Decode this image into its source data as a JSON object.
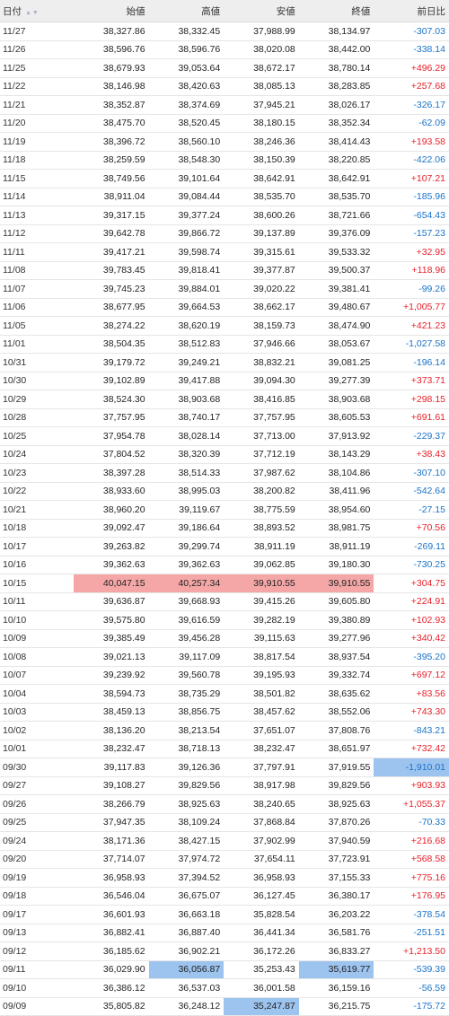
{
  "headers": {
    "date": "日付",
    "open": "始値",
    "high": "高値",
    "low": "安値",
    "close": "終値",
    "change": "前日比"
  },
  "colors": {
    "up": "#e8202a",
    "down": "#1a73c9",
    "highlight_max": "#f5a7a7",
    "highlight_min": "#9dc3ef"
  },
  "rows": [
    {
      "date": "11/27",
      "open": "38,327.86",
      "high": "38,332.45",
      "low": "37,988.99",
      "close": "38,134.97",
      "change": "-307.03"
    },
    {
      "date": "11/26",
      "open": "38,596.76",
      "high": "38,596.76",
      "low": "38,020.08",
      "close": "38,442.00",
      "change": "-338.14"
    },
    {
      "date": "11/25",
      "open": "38,679.93",
      "high": "39,053.64",
      "low": "38,672.17",
      "close": "38,780.14",
      "change": "+496.29"
    },
    {
      "date": "11/22",
      "open": "38,146.98",
      "high": "38,420.63",
      "low": "38,085.13",
      "close": "38,283.85",
      "change": "+257.68"
    },
    {
      "date": "11/21",
      "open": "38,352.87",
      "high": "38,374.69",
      "low": "37,945.21",
      "close": "38,026.17",
      "change": "-326.17"
    },
    {
      "date": "11/20",
      "open": "38,475.70",
      "high": "38,520.45",
      "low": "38,180.15",
      "close": "38,352.34",
      "change": "-62.09"
    },
    {
      "date": "11/19",
      "open": "38,396.72",
      "high": "38,560.10",
      "low": "38,246.36",
      "close": "38,414.43",
      "change": "+193.58"
    },
    {
      "date": "11/18",
      "open": "38,259.59",
      "high": "38,548.30",
      "low": "38,150.39",
      "close": "38,220.85",
      "change": "-422.06"
    },
    {
      "date": "11/15",
      "open": "38,749.56",
      "high": "39,101.64",
      "low": "38,642.91",
      "close": "38,642.91",
      "change": "+107.21"
    },
    {
      "date": "11/14",
      "open": "38,911.04",
      "high": "39,084.44",
      "low": "38,535.70",
      "close": "38,535.70",
      "change": "-185.96"
    },
    {
      "date": "11/13",
      "open": "39,317.15",
      "high": "39,377.24",
      "low": "38,600.26",
      "close": "38,721.66",
      "change": "-654.43"
    },
    {
      "date": "11/12",
      "open": "39,642.78",
      "high": "39,866.72",
      "low": "39,137.89",
      "close": "39,376.09",
      "change": "-157.23"
    },
    {
      "date": "11/11",
      "open": "39,417.21",
      "high": "39,598.74",
      "low": "39,315.61",
      "close": "39,533.32",
      "change": "+32.95"
    },
    {
      "date": "11/08",
      "open": "39,783.45",
      "high": "39,818.41",
      "low": "39,377.87",
      "close": "39,500.37",
      "change": "+118.96"
    },
    {
      "date": "11/07",
      "open": "39,745.23",
      "high": "39,884.01",
      "low": "39,020.22",
      "close": "39,381.41",
      "change": "-99.26"
    },
    {
      "date": "11/06",
      "open": "38,677.95",
      "high": "39,664.53",
      "low": "38,662.17",
      "close": "39,480.67",
      "change": "+1,005.77"
    },
    {
      "date": "11/05",
      "open": "38,274.22",
      "high": "38,620.19",
      "low": "38,159.73",
      "close": "38,474.90",
      "change": "+421.23"
    },
    {
      "date": "11/01",
      "open": "38,504.35",
      "high": "38,512.83",
      "low": "37,946.66",
      "close": "38,053.67",
      "change": "-1,027.58"
    },
    {
      "date": "10/31",
      "open": "39,179.72",
      "high": "39,249.21",
      "low": "38,832.21",
      "close": "39,081.25",
      "change": "-196.14"
    },
    {
      "date": "10/30",
      "open": "39,102.89",
      "high": "39,417.88",
      "low": "39,094.30",
      "close": "39,277.39",
      "change": "+373.71"
    },
    {
      "date": "10/29",
      "open": "38,524.30",
      "high": "38,903.68",
      "low": "38,416.85",
      "close": "38,903.68",
      "change": "+298.15"
    },
    {
      "date": "10/28",
      "open": "37,757.95",
      "high": "38,740.17",
      "low": "37,757.95",
      "close": "38,605.53",
      "change": "+691.61"
    },
    {
      "date": "10/25",
      "open": "37,954.78",
      "high": "38,028.14",
      "low": "37,713.00",
      "close": "37,913.92",
      "change": "-229.37"
    },
    {
      "date": "10/24",
      "open": "37,804.52",
      "high": "38,320.39",
      "low": "37,712.19",
      "close": "38,143.29",
      "change": "+38.43"
    },
    {
      "date": "10/23",
      "open": "38,397.28",
      "high": "38,514.33",
      "low": "37,987.62",
      "close": "38,104.86",
      "change": "-307.10"
    },
    {
      "date": "10/22",
      "open": "38,933.60",
      "high": "38,995.03",
      "low": "38,200.82",
      "close": "38,411.96",
      "change": "-542.64"
    },
    {
      "date": "10/21",
      "open": "38,960.20",
      "high": "39,119.67",
      "low": "38,775.59",
      "close": "38,954.60",
      "change": "-27.15"
    },
    {
      "date": "10/18",
      "open": "39,092.47",
      "high": "39,186.64",
      "low": "38,893.52",
      "close": "38,981.75",
      "change": "+70.56"
    },
    {
      "date": "10/17",
      "open": "39,263.82",
      "high": "39,299.74",
      "low": "38,911.19",
      "close": "38,911.19",
      "change": "-269.11"
    },
    {
      "date": "10/16",
      "open": "39,362.63",
      "high": "39,362.63",
      "low": "39,062.85",
      "close": "39,180.30",
      "change": "-730.25"
    },
    {
      "date": "10/15",
      "open": "40,047.15",
      "high": "40,257.34",
      "low": "39,910.55",
      "close": "39,910.55",
      "change": "+304.75",
      "hl": [
        "open",
        "high",
        "low",
        "close"
      ],
      "hl_type": "max"
    },
    {
      "date": "10/11",
      "open": "39,636.87",
      "high": "39,668.93",
      "low": "39,415.26",
      "close": "39,605.80",
      "change": "+224.91"
    },
    {
      "date": "10/10",
      "open": "39,575.80",
      "high": "39,616.59",
      "low": "39,282.19",
      "close": "39,380.89",
      "change": "+102.93"
    },
    {
      "date": "10/09",
      "open": "39,385.49",
      "high": "39,456.28",
      "low": "39,115.63",
      "close": "39,277.96",
      "change": "+340.42"
    },
    {
      "date": "10/08",
      "open": "39,021.13",
      "high": "39,117.09",
      "low": "38,817.54",
      "close": "38,937.54",
      "change": "-395.20"
    },
    {
      "date": "10/07",
      "open": "39,239.92",
      "high": "39,560.78",
      "low": "39,195.93",
      "close": "39,332.74",
      "change": "+697.12"
    },
    {
      "date": "10/04",
      "open": "38,594.73",
      "high": "38,735.29",
      "low": "38,501.82",
      "close": "38,635.62",
      "change": "+83.56"
    },
    {
      "date": "10/03",
      "open": "38,459.13",
      "high": "38,856.75",
      "low": "38,457.62",
      "close": "38,552.06",
      "change": "+743.30"
    },
    {
      "date": "10/02",
      "open": "38,136.20",
      "high": "38,213.54",
      "low": "37,651.07",
      "close": "37,808.76",
      "change": "-843.21"
    },
    {
      "date": "10/01",
      "open": "38,232.47",
      "high": "38,718.13",
      "low": "38,232.47",
      "close": "38,651.97",
      "change": "+732.42"
    },
    {
      "date": "09/30",
      "open": "39,117.83",
      "high": "39,126.36",
      "low": "37,797.91",
      "close": "37,919.55",
      "change": "-1,910.01",
      "hl": [
        "change"
      ],
      "hl_type": "min"
    },
    {
      "date": "09/27",
      "open": "39,108.27",
      "high": "39,829.56",
      "low": "38,917.98",
      "close": "39,829.56",
      "change": "+903.93"
    },
    {
      "date": "09/26",
      "open": "38,266.79",
      "high": "38,925.63",
      "low": "38,240.65",
      "close": "38,925.63",
      "change": "+1,055.37"
    },
    {
      "date": "09/25",
      "open": "37,947.35",
      "high": "38,109.24",
      "low": "37,868.84",
      "close": "37,870.26",
      "change": "-70.33"
    },
    {
      "date": "09/24",
      "open": "38,171.36",
      "high": "38,427.15",
      "low": "37,902.99",
      "close": "37,940.59",
      "change": "+216.68"
    },
    {
      "date": "09/20",
      "open": "37,714.07",
      "high": "37,974.72",
      "low": "37,654.11",
      "close": "37,723.91",
      "change": "+568.58"
    },
    {
      "date": "09/19",
      "open": "36,958.93",
      "high": "37,394.52",
      "low": "36,958.93",
      "close": "37,155.33",
      "change": "+775.16"
    },
    {
      "date": "09/18",
      "open": "36,546.04",
      "high": "36,675.07",
      "low": "36,127.45",
      "close": "36,380.17",
      "change": "+176.95"
    },
    {
      "date": "09/17",
      "open": "36,601.93",
      "high": "36,663.18",
      "low": "35,828.54",
      "close": "36,203.22",
      "change": "-378.54"
    },
    {
      "date": "09/13",
      "open": "36,882.41",
      "high": "36,887.40",
      "low": "36,441.34",
      "close": "36,581.76",
      "change": "-251.51"
    },
    {
      "date": "09/12",
      "open": "36,185.62",
      "high": "36,902.21",
      "low": "36,172.26",
      "close": "36,833.27",
      "change": "+1,213.50"
    },
    {
      "date": "09/11",
      "open": "36,029.90",
      "high": "36,056.87",
      "low": "35,253.43",
      "close": "35,619.77",
      "change": "-539.39",
      "hl": [
        "high",
        "close"
      ],
      "hl_type": "min"
    },
    {
      "date": "09/10",
      "open": "36,386.12",
      "high": "36,537.03",
      "low": "36,001.58",
      "close": "36,159.16",
      "change": "-56.59"
    },
    {
      "date": "09/09",
      "open": "35,805.82",
      "high": "36,248.12",
      "low": "35,247.87",
      "close": "36,215.75",
      "change": "-175.72",
      "hl": [
        "low"
      ],
      "hl_type": "min"
    }
  ]
}
